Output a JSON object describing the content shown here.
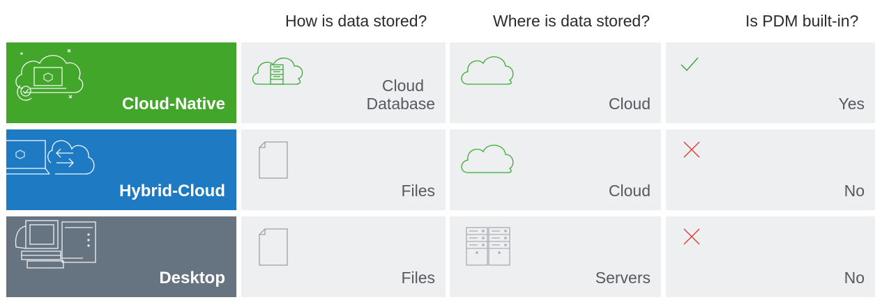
{
  "headers": {
    "how": "How is data stored?",
    "where": "Where is data stored?",
    "pdm": "Is PDM built-in?"
  },
  "colors": {
    "cloud_native": "#41a62a",
    "hybrid_cloud": "#1d7ac3",
    "desktop": "#667482",
    "cell_bg": "#eeeff1",
    "green_icon": "#3aa935",
    "red_cross": "#e0403a",
    "gray_icon": "#9aa0a6"
  },
  "rows": [
    {
      "label": "Cloud-Native",
      "how_line1": "Cloud",
      "how_line2": "Database",
      "how_icon": "cloud-database-icon",
      "where": "Cloud",
      "where_icon": "cloud-icon",
      "pdm": "Yes",
      "pdm_icon": "check-icon"
    },
    {
      "label": "Hybrid-Cloud",
      "how": "Files",
      "how_icon": "file-icon",
      "where": "Cloud",
      "where_icon": "cloud-icon",
      "pdm": "No",
      "pdm_icon": "cross-icon"
    },
    {
      "label": "Desktop",
      "how": "Files",
      "how_icon": "file-icon",
      "where": "Servers",
      "where_icon": "servers-icon",
      "pdm": "No",
      "pdm_icon": "cross-icon"
    }
  ]
}
